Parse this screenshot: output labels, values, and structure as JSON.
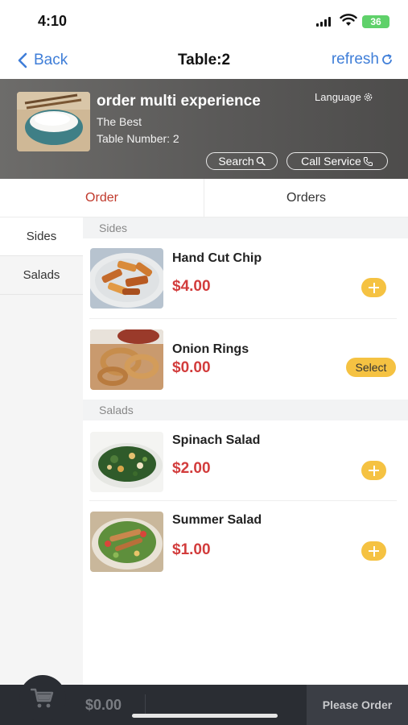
{
  "status_bar": {
    "time": "4:10",
    "battery": "36"
  },
  "nav": {
    "back_label": "Back",
    "title": "Table:2",
    "refresh_label": "refresh"
  },
  "store": {
    "name": "order multi experience",
    "subtitle": "The Best",
    "table_number": "Table Number: 2",
    "language_label": "Language",
    "search_label": "Search",
    "call_service_label": "Call Service"
  },
  "tabs": [
    {
      "label": "Order",
      "active": true
    },
    {
      "label": "Orders",
      "active": false
    }
  ],
  "categories": [
    {
      "label": "Sides",
      "active": true
    },
    {
      "label": "Salads",
      "active": false
    }
  ],
  "sections": [
    {
      "title": "Sides",
      "items": [
        {
          "name": "Hand Cut Chip",
          "price": "$4.00",
          "action": "add"
        },
        {
          "name": "Onion Rings",
          "price": "$0.00",
          "action": "select",
          "action_label": "Select"
        }
      ]
    },
    {
      "title": "Salads",
      "items": [
        {
          "name": "Spinach Salad",
          "price": "$2.00",
          "action": "add"
        },
        {
          "name": "Summer Salad",
          "price": "$1.00",
          "action": "add"
        }
      ]
    }
  ],
  "bottom_bar": {
    "cart_total": "$0.00",
    "checkout_label": "Please Order"
  },
  "colors": {
    "accent_blue": "#3f7ed8",
    "price_red": "#d23c3c",
    "active_tab": "#c0392b",
    "button_yellow": "#f5c242",
    "bottom_bar": "#2a2d33"
  }
}
